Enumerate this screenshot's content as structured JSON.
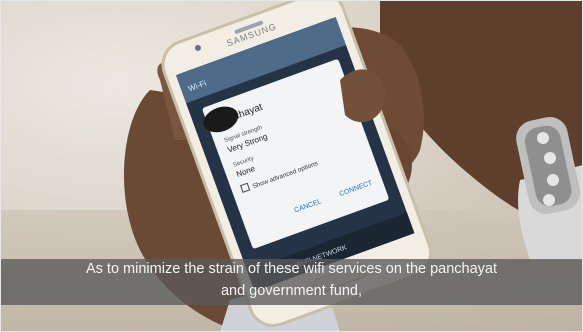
{
  "phone": {
    "brand": "SAMSUNG",
    "screen": {
      "header_label": "Wi-Fi",
      "dialog": {
        "title": "Panchayat",
        "signal_label": "Signal strength",
        "signal_value": "Very Strong",
        "security_label": "Security",
        "security_value": "None",
        "advanced_option": "Show advanced options",
        "cancel_button": "CANCEL",
        "connect_button": "CONNECT"
      },
      "footer_action": "ADD WI-FI NETWORK"
    }
  },
  "subtitle": {
    "line1": "As to minimize the strain of these wifi services on the panchayat",
    "line2": "and government fund,"
  }
}
